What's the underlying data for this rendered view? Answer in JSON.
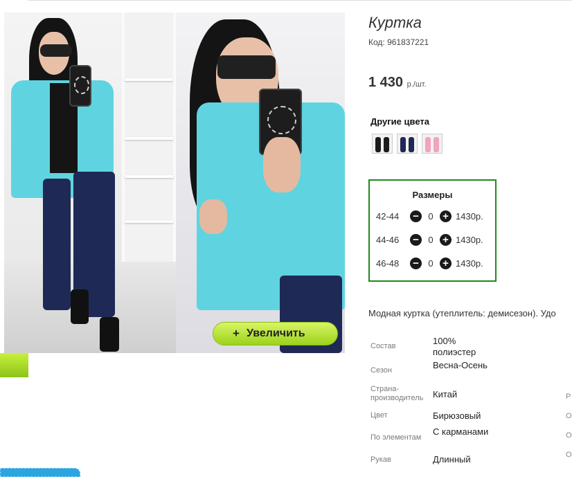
{
  "product": {
    "title": "Куртка",
    "code": "Код: 961837221",
    "price": "1 430",
    "price_unit": "р./шт."
  },
  "gallery": {
    "enlarge_label": "Увеличить",
    "enlarge_icon": "+"
  },
  "colors": {
    "heading": "Другие цвета",
    "swatches": [
      "#1b1b1b",
      "#1e2a55",
      "#f2a3bd"
    ]
  },
  "sizes": {
    "heading": "Размеры",
    "minus_icon": "−",
    "plus_icon": "+",
    "rows": [
      {
        "label": "42-44",
        "qty": "0",
        "price": "1430р."
      },
      {
        "label": "44-46",
        "qty": "0",
        "price": "1430р."
      },
      {
        "label": "46-48",
        "qty": "0",
        "price": "1430р."
      }
    ]
  },
  "description": "Модная куртка (утеплитель: демисезон). Удо",
  "specs": [
    {
      "key": "Состав",
      "value": "100% полиэстер"
    },
    {
      "key": "Сезон",
      "value": "Весна-Осень"
    },
    {
      "key": "Страна-производитель",
      "value": "Китай"
    },
    {
      "key": "Цвет",
      "value": "Бирюзовый"
    },
    {
      "key": "По элементам",
      "value": "С карманами"
    },
    {
      "key": "Рукав",
      "value": "Длинный"
    }
  ],
  "edge_letters": [
    "Р",
    "О",
    "О",
    "О"
  ],
  "accent_colors": {
    "turquoise": "#5fd4e0",
    "green_border": "#1d8a1d",
    "button_green": "#9bd21c"
  }
}
